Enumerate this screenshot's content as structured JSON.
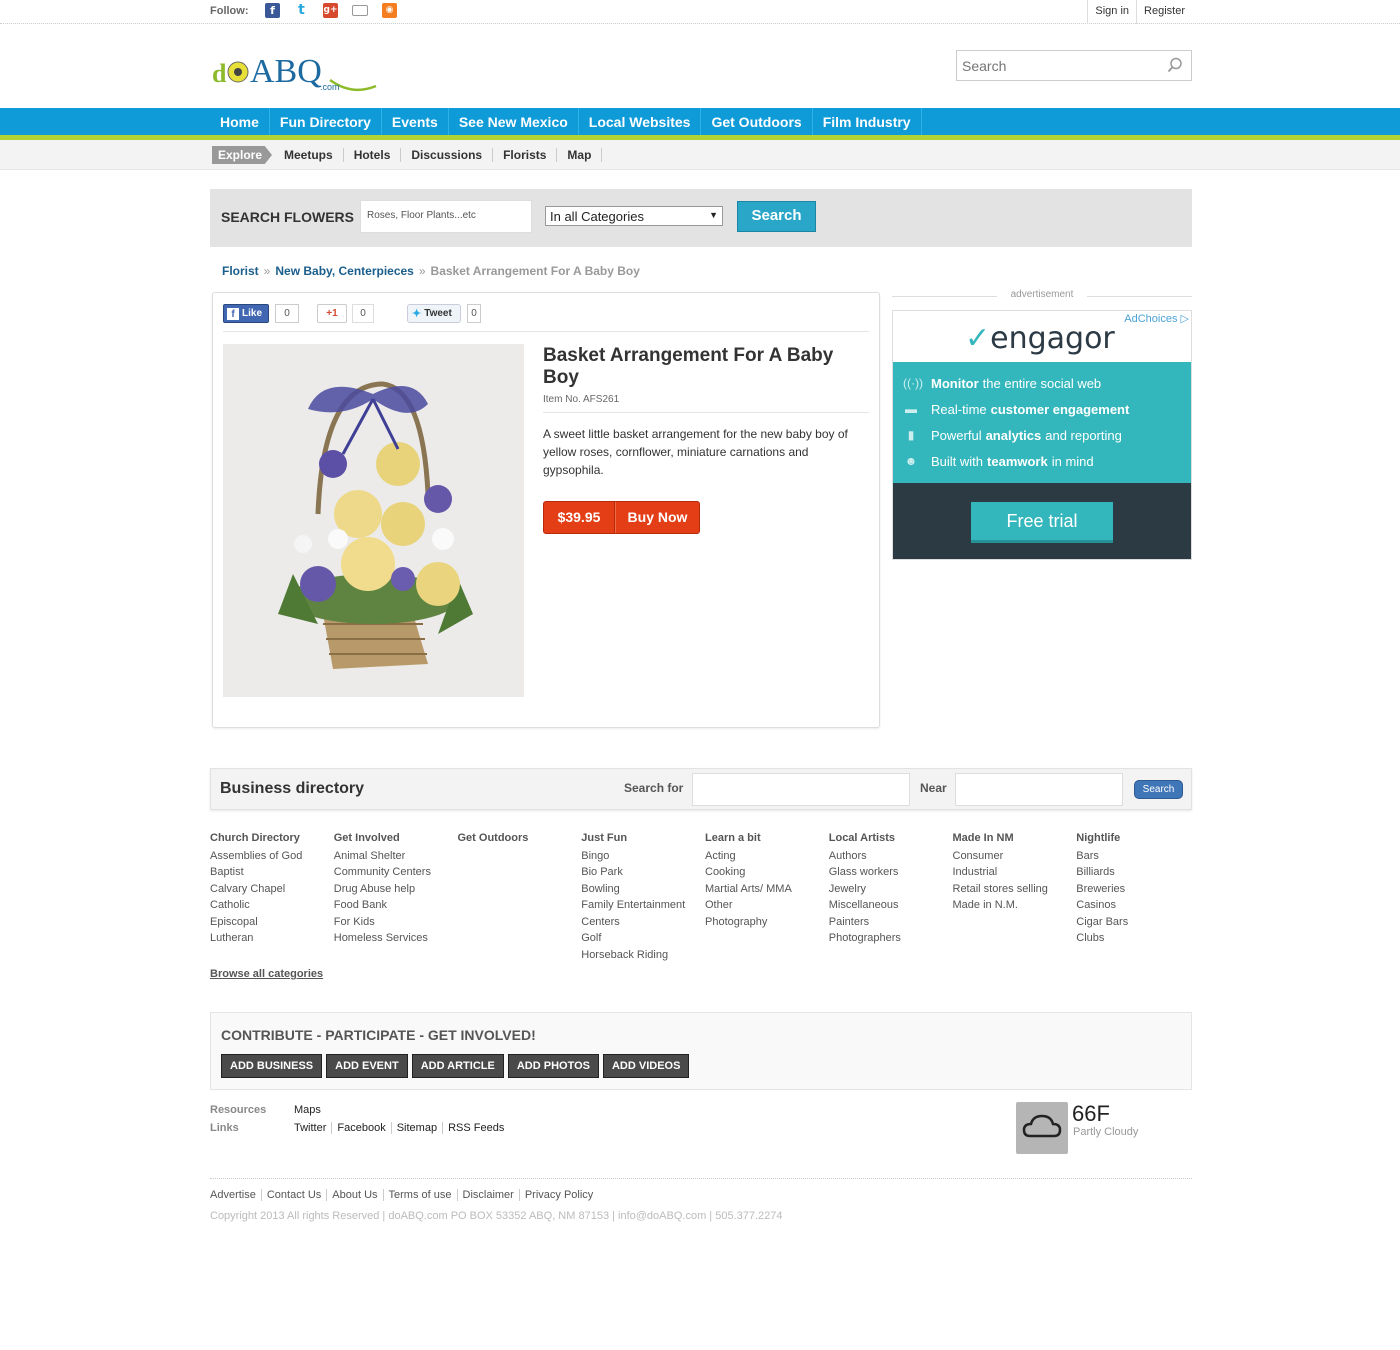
{
  "topbar": {
    "follow_label": "Follow:",
    "sign_in": "Sign in",
    "register": "Register"
  },
  "header": {
    "logo_text": "doABQ",
    "logo_sub": ".com",
    "search_placeholder": "Search"
  },
  "nav": {
    "items": [
      "Home",
      "Fun Directory",
      "Events",
      "See New Mexico",
      "Local Websites",
      "Get Outdoors",
      "Film Industry"
    ]
  },
  "subnav": {
    "explore": "Explore",
    "items": [
      "Meetups",
      "Hotels",
      "Discussions",
      "Florists",
      "Map"
    ]
  },
  "search_flowers": {
    "label": "SEARCH FLOWERS",
    "placeholder": "Roses, Floor Plants...etc",
    "category": "In all Categories",
    "button": "Search"
  },
  "breadcrumb": {
    "first": "Florist",
    "second": "New Baby, Centerpieces",
    "current": "Basket Arrangement For A Baby Boy",
    "sep": "»"
  },
  "social": {
    "like": "Like",
    "like_count": "0",
    "gplus": "+1",
    "gplus_count": "0",
    "tweet": "Tweet",
    "tweet_count": "0"
  },
  "product": {
    "title": "Basket Arrangement For A Baby Boy",
    "item_no": "Item No. AFS261",
    "description": "A sweet little basket arrangement for the new baby boy of yellow roses, cornflower, miniature carnations and gypsophila.",
    "price": "$39.95",
    "buy": "Buy Now"
  },
  "ad": {
    "label": "advertisement",
    "adchoices": "AdChoices",
    "brand": "engagor",
    "rows": [
      {
        "bold": "Monitor",
        "text": "the entire social web"
      },
      {
        "pre": "Real-time",
        "bold": "customer engagement"
      },
      {
        "pre": "Powerful",
        "bold": "analytics",
        "text": "and reporting"
      },
      {
        "pre": "Built with",
        "bold": "teamwork",
        "text": "in mind"
      }
    ],
    "cta": "Free trial"
  },
  "business_directory": {
    "title": "Business directory",
    "search_for": "Search for",
    "near": "Near",
    "button": "Search"
  },
  "categories": [
    {
      "title": "Church Directory",
      "items": [
        "Assemblies of God",
        "Baptist",
        "Calvary Chapel",
        "Catholic",
        "Episcopal",
        "Lutheran"
      ]
    },
    {
      "title": "Get Involved",
      "items": [
        "Animal Shelter",
        "Community Centers",
        "Drug Abuse help",
        "Food Bank",
        "For Kids",
        "Homeless Services"
      ]
    },
    {
      "title": "Get Outdoors",
      "items": []
    },
    {
      "title": "Just Fun",
      "items": [
        "Bingo",
        "Bio Park",
        "Bowling",
        "Family Entertainment Centers",
        "Golf",
        "Horseback Riding"
      ]
    },
    {
      "title": "Learn a bit",
      "items": [
        "Acting",
        "Cooking",
        "Martial Arts/ MMA",
        "Other",
        "Photography"
      ]
    },
    {
      "title": "Local Artists",
      "items": [
        "Authors",
        "Glass workers",
        "Jewelry",
        "Miscellaneous",
        "Painters",
        "Photographers"
      ]
    },
    {
      "title": "Made In NM",
      "items": [
        "Consumer",
        "Industrial",
        "Retail stores selling",
        "Made in N.M."
      ]
    },
    {
      "title": "Nightlife",
      "items": [
        "Bars",
        "Billiards",
        "Breweries",
        "Casinos",
        "Cigar Bars",
        "Clubs"
      ]
    }
  ],
  "browse_all": "Browse all categories",
  "contribute": {
    "title": "CONTRIBUTE - PARTICIPATE - GET INVOLVED!",
    "buttons": [
      "ADD BUSINESS",
      "ADD EVENT",
      "ADD ARTICLE",
      "ADD PHOTOS",
      "ADD VIDEOS"
    ]
  },
  "resources": {
    "label": "Resources",
    "items": [
      "Maps"
    ]
  },
  "links": {
    "label": "Links",
    "items": [
      "Twitter",
      "Facebook",
      "Sitemap",
      "RSS Feeds"
    ]
  },
  "weather": {
    "temp": "66F",
    "condition": "Partly Cloudy"
  },
  "footer": {
    "links": [
      "Advertise",
      "Contact Us",
      "About Us",
      "Terms of use",
      "Disclaimer",
      "Privacy Policy"
    ],
    "copyright": "Copyright 2013 All rights Reserved | doABQ.com PO BOX 53352 ABQ, NM 87153 | info@doABQ.com | 505.377.2274"
  },
  "colors": {
    "nav": "#0e9bd8",
    "nav_accent": "#b3d236",
    "buy": "#e33e16",
    "search_btn": "#29a6c8",
    "ad_teal": "#34b7bc",
    "ad_dark": "#2c3a44"
  }
}
